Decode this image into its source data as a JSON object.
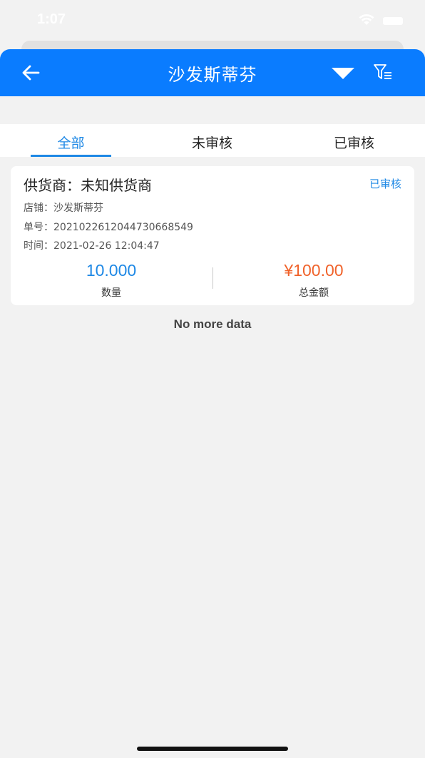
{
  "status_bar": {
    "time": "1:07"
  },
  "header": {
    "title": "沙发斯蒂芬"
  },
  "tabs": [
    {
      "label": "全部",
      "active": true
    },
    {
      "label": "未审核",
      "active": false
    },
    {
      "label": "已审核",
      "active": false
    }
  ],
  "orders": [
    {
      "supplier": "供货商：未知供货商",
      "status": "已审核",
      "store": "店铺：沙发斯蒂芬",
      "order_no": "单号：20210226120447306685​49",
      "time": "时间：2021-02-26 12:04:47",
      "quantity_value": "10.000",
      "quantity_label": "数量",
      "amount_value": "¥100.00",
      "amount_label": "总金额"
    }
  ],
  "footer_text": "No more data",
  "colors": {
    "primary": "#0a7cff",
    "tab_active": "#1e88e5",
    "amount": "#f0622a",
    "quantity": "#1e88e5"
  },
  "icons": [
    "back-arrow-icon",
    "dropdown-triangle-icon",
    "filter-icon",
    "wifi-icon",
    "battery-icon"
  ]
}
